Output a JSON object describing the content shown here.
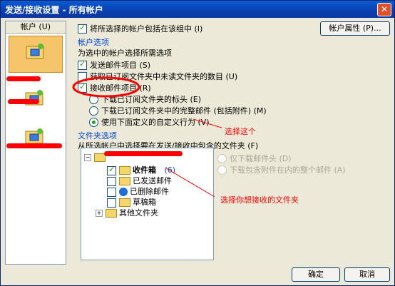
{
  "title": "发送/接收设置 - 所有帐户",
  "close_symbol": "✕",
  "left_header": "帐户 (U)",
  "main": {
    "include_in_group": "将所选择的帐户包括在该组中 (I)",
    "account_props_btn": "帐户属性 (P)...",
    "account_options_title": "帐户选项",
    "select_options_text": "为选中的帐户选择所需选项",
    "send_items": "发送邮件项目 (S)",
    "unread_count": "获取已订阅文件夹中未读文件夹的数目 (U)",
    "receive_items": "接收邮件项目 (R)",
    "opt_headers": "下载已订阅文件夹的标头 (E)",
    "opt_full": "下载已订阅文件夹中的完整邮件 (包括附件) (M)",
    "opt_custom": "使用下面定义的自定义行为 (V)",
    "folder_options_title": "文件夹选项",
    "folder_prompt": "从所选帐户中选择要在发送/接收中包含的文件夹 (F)",
    "right_opt1": "仅下载邮件头 (D)",
    "right_opt2": "下载包含附件在内的整个邮件 (A)"
  },
  "tree": {
    "inbox": "收件箱",
    "inbox_count": "(6)",
    "sent": "已发送邮件",
    "deleted": "已删除邮件",
    "drafts": "草稿箱",
    "other": "其他文件夹"
  },
  "annotations": {
    "choose_this": "选择这个",
    "choose_folder": "选择你想接收的文件夹"
  },
  "buttons": {
    "ok": "确定",
    "cancel": "取消"
  },
  "colors": {
    "annotation": "#ff0000",
    "group_title": "#0046d5"
  }
}
